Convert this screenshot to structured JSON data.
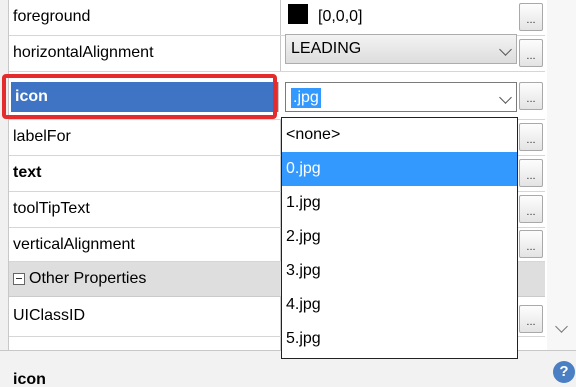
{
  "properties": {
    "foreground": {
      "label": "foreground",
      "value": "[0,0,0]",
      "swatch": "#000000"
    },
    "horizontal_alignment": {
      "label": "horizontalAlignment",
      "value": "LEADING"
    },
    "icon": {
      "label": "icon",
      "value": ".jpg"
    },
    "label_for": {
      "label": "labelFor"
    },
    "text": {
      "label": "text"
    },
    "tooltip_text": {
      "label": "toolTipText"
    },
    "vertical_alignment": {
      "label": "verticalAlignment"
    },
    "ui_class_id": {
      "label": "UIClassID"
    }
  },
  "category": {
    "label": "Other Properties"
  },
  "ellipsis_label": "...",
  "dropdown": {
    "options": [
      "<none>",
      "0.jpg",
      "1.jpg",
      "2.jpg",
      "3.jpg",
      "4.jpg",
      "5.jpg"
    ],
    "selected": "0.jpg"
  },
  "bottom": {
    "title": "icon",
    "help": "?"
  },
  "colors": {
    "selection": "#3399ff",
    "selected_row": "#3f74c4",
    "highlight_box": "#e52b2b"
  }
}
